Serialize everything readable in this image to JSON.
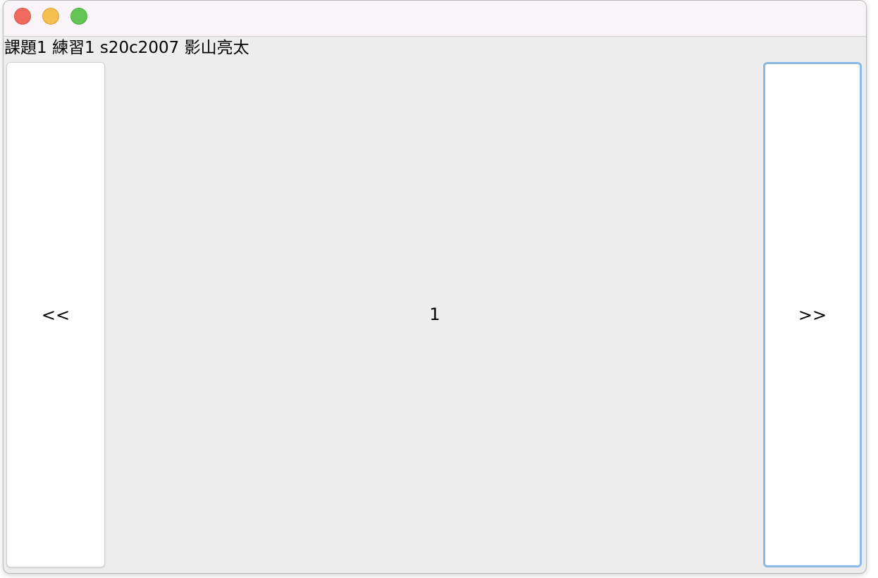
{
  "window": {
    "title": ""
  },
  "header": {
    "label": "課題1 練習1 s20c2007 影山亮太"
  },
  "navigation": {
    "prev_label": "<<",
    "next_label": ">>"
  },
  "content": {
    "page_number": "1"
  },
  "colors": {
    "close": "#ee6a5f",
    "minimize": "#f5bf4f",
    "maximize": "#62c554",
    "focus_ring": "#8cbae8",
    "window_bg": "#ededed"
  }
}
